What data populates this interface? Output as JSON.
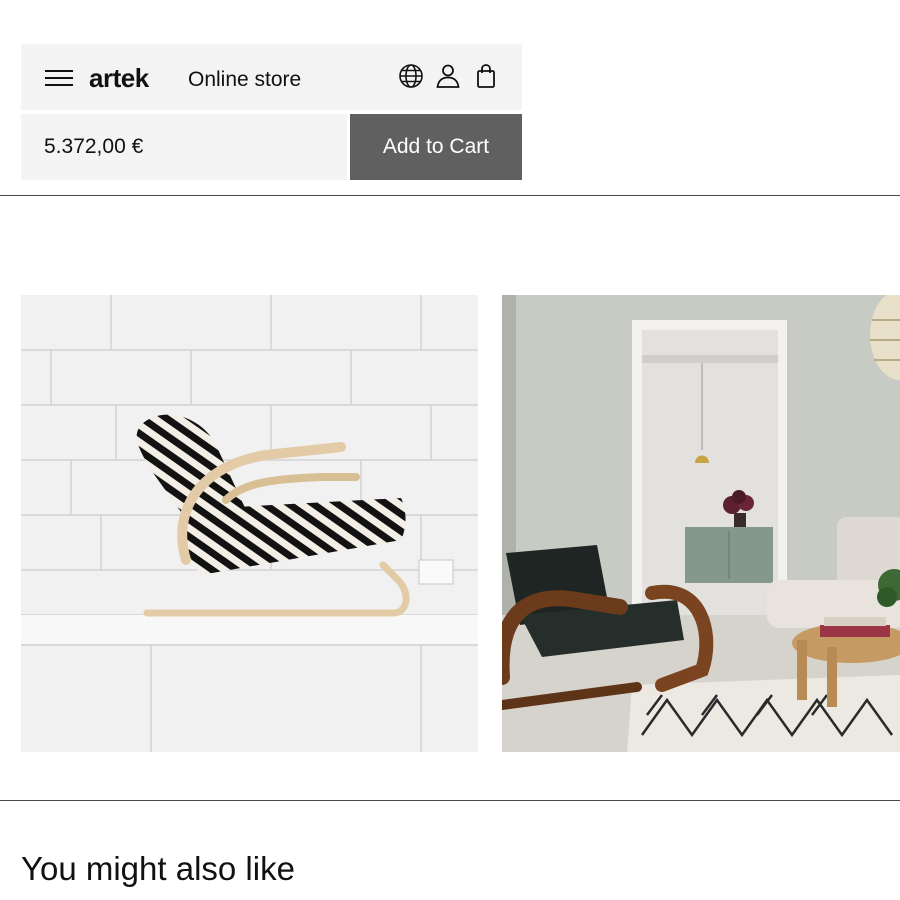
{
  "header": {
    "brand": "artek",
    "store_label": "Online store",
    "menu_icon": "hamburger-menu-icon",
    "icons": [
      "globe-icon",
      "user-icon",
      "shopping-bag-icon"
    ]
  },
  "product": {
    "price": "5.372,00 €",
    "add_to_cart_label": "Add to Cart"
  },
  "gallery": {
    "images": [
      {
        "name": "zebra-armchair-photo",
        "subject": "armchair with zebra upholstery on white tiled wall"
      },
      {
        "name": "living-room-armchair-photo",
        "subject": "dark armchair in living room with pendant lamp"
      }
    ]
  },
  "recommendations": {
    "title": "You might also like"
  },
  "colors": {
    "panel_bg": "#f4f4f4",
    "button_bg": "#606060",
    "button_text": "#ffffff",
    "text": "#111111"
  }
}
